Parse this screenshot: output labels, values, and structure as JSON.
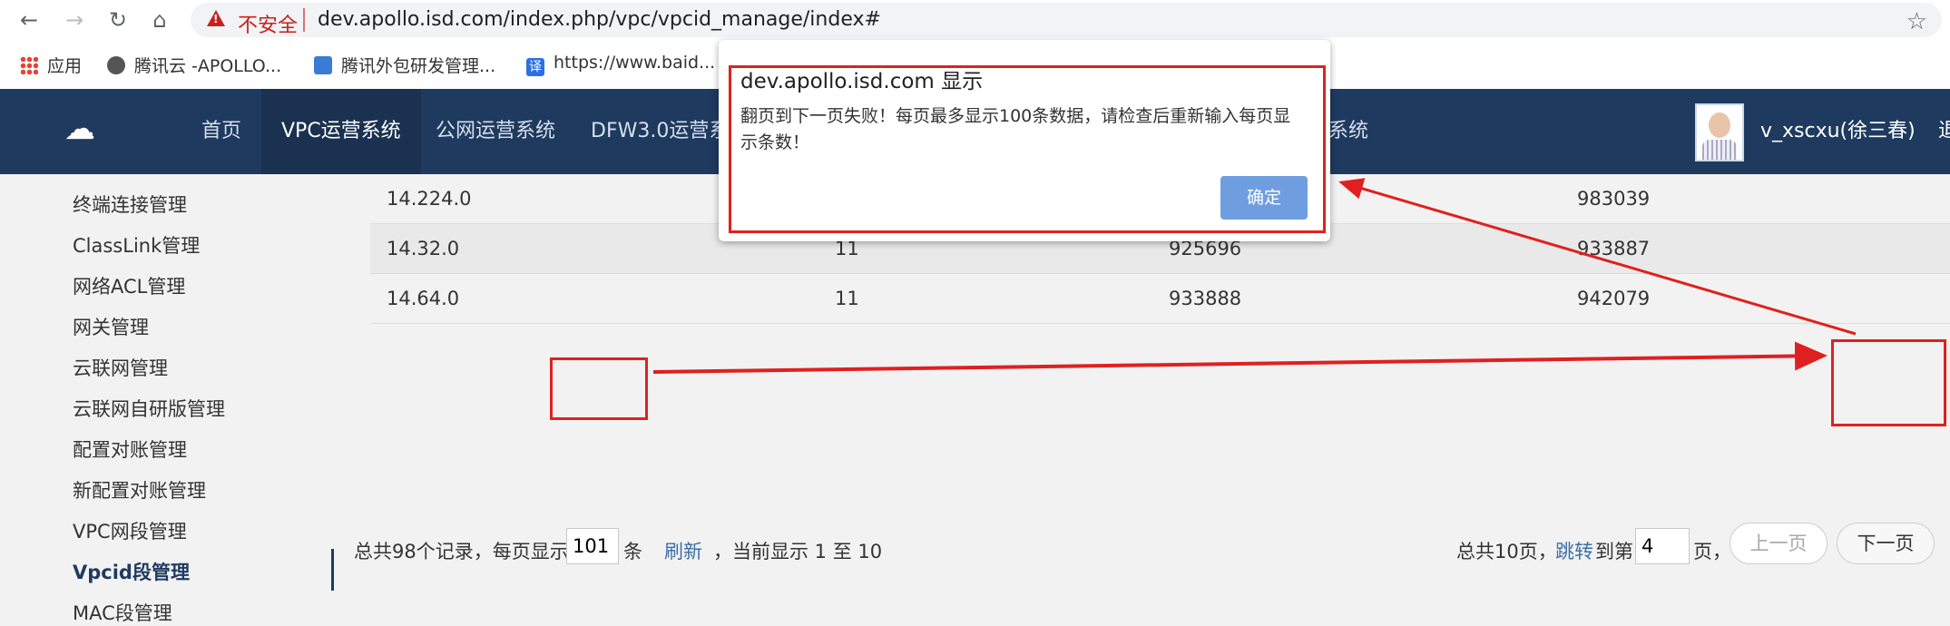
{
  "browser": {
    "url": "dev.apollo.isd.com/index.php/vpc/vpcid_manage/index#",
    "insecure_label": "不安全",
    "bookmarks": [
      {
        "label": "应用"
      },
      {
        "label": "腾讯云 -APOLLO..."
      },
      {
        "label": "腾讯外包研发管理..."
      },
      {
        "label": "https://www.baid..."
      }
    ]
  },
  "topnav": {
    "items": [
      {
        "label": "首页"
      },
      {
        "label": "VPC运营系统"
      },
      {
        "label": "公网运营系统"
      },
      {
        "label": "DFW3.0运营系"
      },
      {
        "label": "系统"
      }
    ],
    "username": "v_xscxu(徐三春)",
    "logout": "退"
  },
  "sidebar": {
    "items": [
      {
        "label": "终端连接管理"
      },
      {
        "label": "ClassLink管理"
      },
      {
        "label": "网络ACL管理"
      },
      {
        "label": "网关管理"
      },
      {
        "label": "云联网管理"
      },
      {
        "label": "云联网自研版管理"
      },
      {
        "label": "配置对账管理"
      },
      {
        "label": "新配置对账管理"
      },
      {
        "label": "VPC网段管理"
      },
      {
        "label": "Vpcid段管理"
      },
      {
        "label": "MAC段管理"
      }
    ]
  },
  "table": {
    "rows": [
      {
        "c1": "14.224.0",
        "c2": "",
        "c3": "",
        "c4": "983039"
      },
      {
        "c1": "14.32.0",
        "c2": "11",
        "c3": "925696",
        "c4": "933887"
      },
      {
        "c1": "14.64.0",
        "c2": "11",
        "c3": "933888",
        "c4": "942079"
      }
    ]
  },
  "pager": {
    "total_prefix": "总共98个记录，每页显示",
    "page_size": "101",
    "unit": "条",
    "refresh": "刷新",
    "current": "，当前显示 1 至 10",
    "total_pages": "总共10页，",
    "jump": "跳转",
    "to_page": "到第",
    "jump_page": "4",
    "page_unit": "页，",
    "prev": "上一页",
    "next": "下一页"
  },
  "dialog": {
    "title": "dev.apollo.isd.com 显示",
    "message": "翻页到下一页失败！每页最多显示100条数据，请检查后重新输入每页显示条数！",
    "ok": "确定"
  },
  "colors": {
    "nav_bg": "#1f3a5f",
    "annotation_red": "#e02020",
    "ok_button": "#6f9ee0"
  }
}
